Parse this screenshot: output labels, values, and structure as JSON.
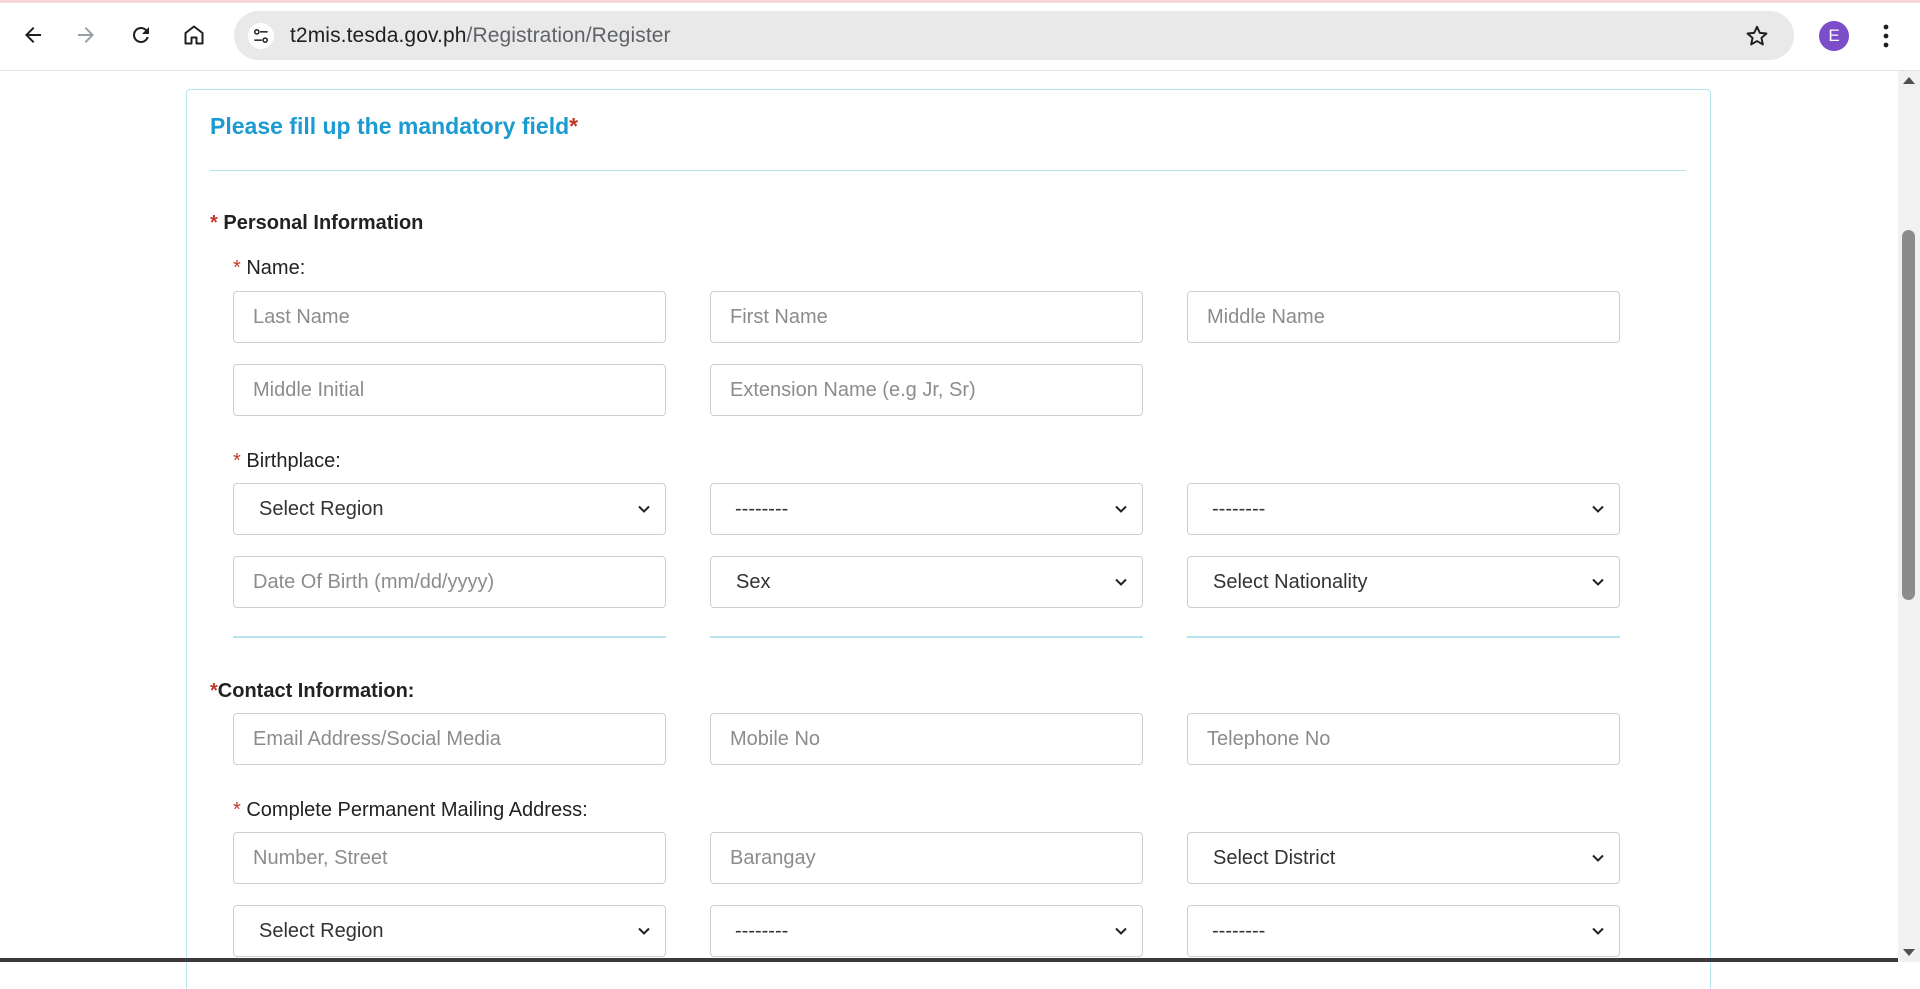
{
  "browser": {
    "url_domain": "t2mis.tesda.gov.ph",
    "url_path": "/Registration/Register",
    "profile_initial": "E"
  },
  "form": {
    "title": "Please fill up the mandatory field",
    "title_required_mark": "*",
    "personal_information": {
      "label": "Personal Information",
      "name_label": "Name:",
      "last_name_placeholder": "Last Name",
      "first_name_placeholder": "First Name",
      "middle_name_placeholder": "Middle Name",
      "middle_initial_placeholder": "Middle Initial",
      "extension_name_placeholder": "Extension Name (e.g Jr, Sr)",
      "birthplace_label": "Birthplace:",
      "region_select": "Select Region",
      "province_select": "--------",
      "city_select": "--------",
      "dob_placeholder": "Date Of Birth (mm/dd/yyyy)",
      "sex_select": "Sex",
      "nationality_select": "Select Nationality"
    },
    "contact_information": {
      "label": "Contact Information:",
      "email_placeholder": "Email Address/Social Media",
      "mobile_placeholder": "Mobile No",
      "telephone_placeholder": "Telephone No",
      "address_label": "Complete Permanent Mailing Address:",
      "street_placeholder": "Number, Street",
      "barangay_placeholder": "Barangay",
      "district_select": "Select District",
      "region_select": "Select Region",
      "province_select": "--------",
      "city_select": "--------"
    },
    "required_mark": "*"
  }
}
